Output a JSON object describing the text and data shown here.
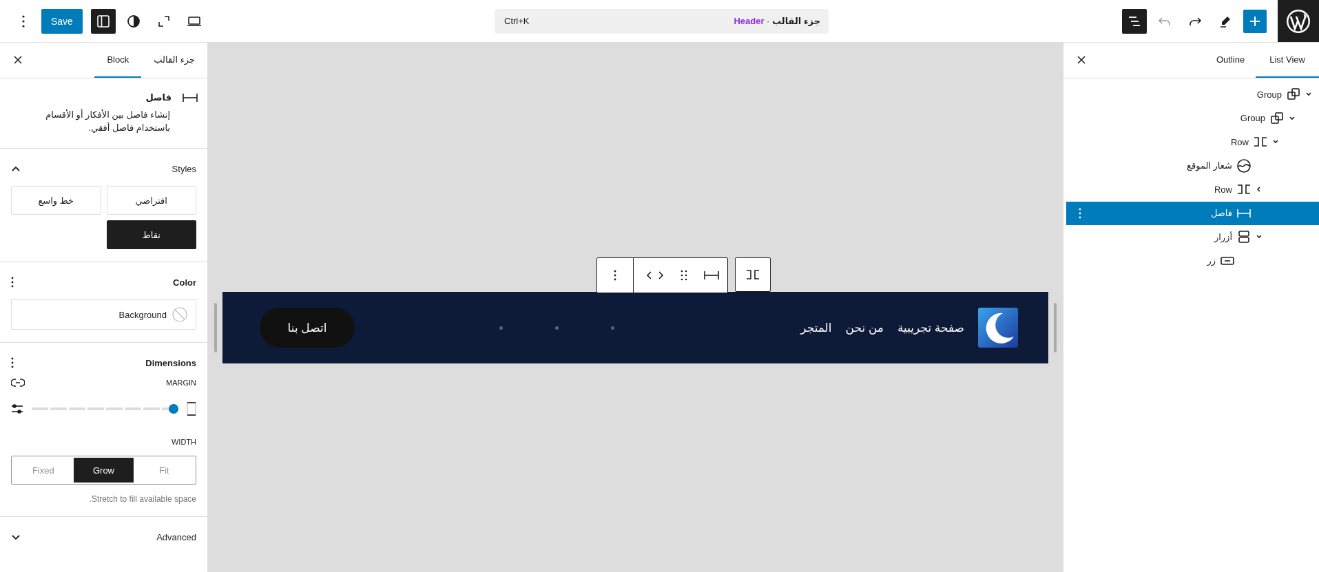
{
  "topbar": {
    "save": "Save",
    "command": {
      "shortcut": "Ctrl+K",
      "section": "جزء القالب",
      "separator": "·",
      "title": "Header"
    }
  },
  "left_panel": {
    "tabs": [
      {
        "label": "جزء القالب",
        "selected": false
      },
      {
        "label": "Block",
        "selected": true
      }
    ],
    "block": {
      "name": "فاصل",
      "description": "إنشاء فاصل بين الأفكار أو الأقسام باستخدام فاصل أفقي."
    },
    "styles": {
      "title": "Styles",
      "expanded": true,
      "options": [
        {
          "label": "افتراضي",
          "selected": false
        },
        {
          "label": "خط واسع",
          "selected": false
        },
        {
          "label": "نقاط",
          "selected": true
        }
      ]
    },
    "color": {
      "title": "Color",
      "background": "Background"
    },
    "dimensions": {
      "title": "Dimensions",
      "margin_label": "MARGIN",
      "margin": {
        "level": 1
      },
      "width_label": "WIDTH",
      "width_options": [
        {
          "label": "Fit",
          "selected": false
        },
        {
          "label": "Grow",
          "selected": true
        },
        {
          "label": "Fixed",
          "selected": false
        }
      ],
      "help": "Stretch to fill available space."
    },
    "advanced": {
      "title": "Advanced",
      "expanded": false
    }
  },
  "canvas": {
    "nav": [
      "صفحة تجريبية",
      "من نحن",
      "المتجر"
    ],
    "button": "اتصل بنا"
  },
  "right_panel": {
    "tabs": [
      {
        "label": "List View",
        "selected": true
      },
      {
        "label": "Outline",
        "selected": false
      }
    ],
    "tree": [
      {
        "label": "Group",
        "kind": "group",
        "expanded": true,
        "selected": false,
        "children": [
          {
            "label": "Group",
            "kind": "group",
            "expanded": true,
            "selected": false,
            "children": [
              {
                "label": "Row",
                "kind": "row",
                "expanded": true,
                "selected": false,
                "children": [
                  {
                    "label": "شعار الموقع",
                    "kind": "logo",
                    "selected": false
                  },
                  {
                    "label": "Row",
                    "kind": "row",
                    "expanded": false,
                    "selected": false
                  },
                  {
                    "label": "فاصل",
                    "kind": "separator",
                    "selected": true
                  },
                  {
                    "label": "أزرار",
                    "kind": "buttons",
                    "expanded": true,
                    "selected": false,
                    "children": [
                      {
                        "label": "زر",
                        "kind": "button",
                        "selected": false
                      }
                    ]
                  }
                ]
              }
            ]
          }
        ]
      }
    ]
  }
}
